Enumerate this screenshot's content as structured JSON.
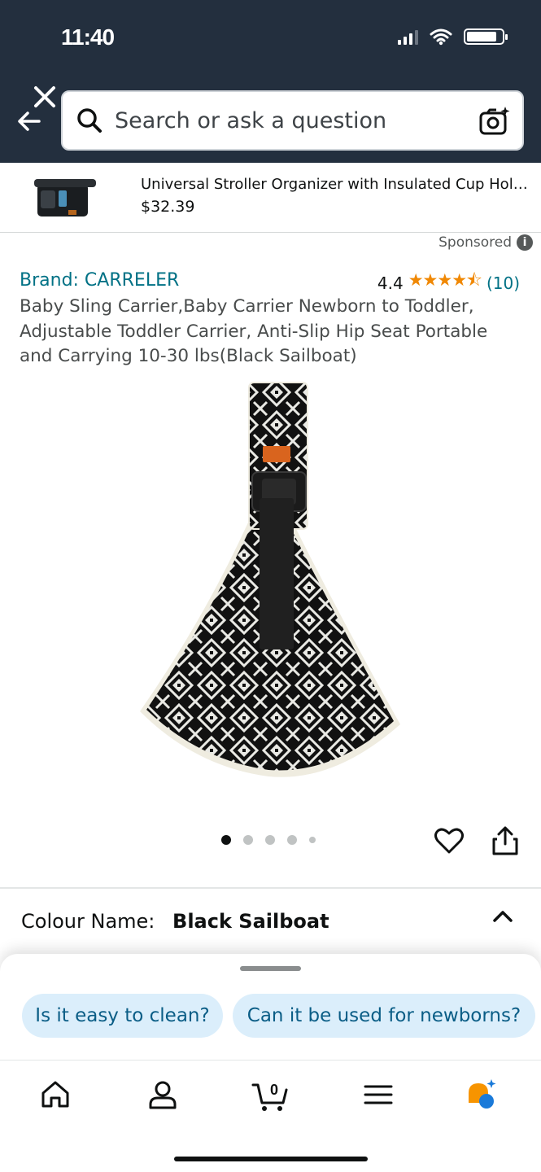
{
  "status_bar": {
    "time": "11:40"
  },
  "header": {
    "search_placeholder": "Search or ask a question"
  },
  "sponsored_product": {
    "title": "Universal Stroller Organizer with Insulated Cup Holder Detachable Phone Bag",
    "price": "$32.39"
  },
  "sponsored_label": "Sponsored",
  "product": {
    "brand": "Brand: CARRELER",
    "rating_value": "4.4",
    "rating_stars": 4.4,
    "stars_display": "★★★★⯪",
    "rating_count": "(10)",
    "title": "Baby Sling Carrier,Baby Carrier Newborn to Toddler, Adjustable Toddler Carrier, Anti-Slip Hip Seat Portable and Carrying 10-30 lbs(Black Sailboat)",
    "image_count": 5,
    "active_image": 1
  },
  "variation": {
    "label": "Colour Name:",
    "value": "Black Sailboat"
  },
  "rufus": {
    "suggestions": [
      "Is it easy to clean?",
      "Can it be used for newborns?"
    ]
  },
  "bottom_nav": {
    "cart_count": "0",
    "items": [
      "home-icon",
      "account-icon",
      "cart-icon",
      "menu-icon",
      "rufus-icon"
    ]
  },
  "colors": {
    "header_bg": "#232f3e",
    "link": "#007185",
    "star": "#f08804",
    "chip_bg": "#dbeefb",
    "chip_text": "#0a5d86"
  }
}
